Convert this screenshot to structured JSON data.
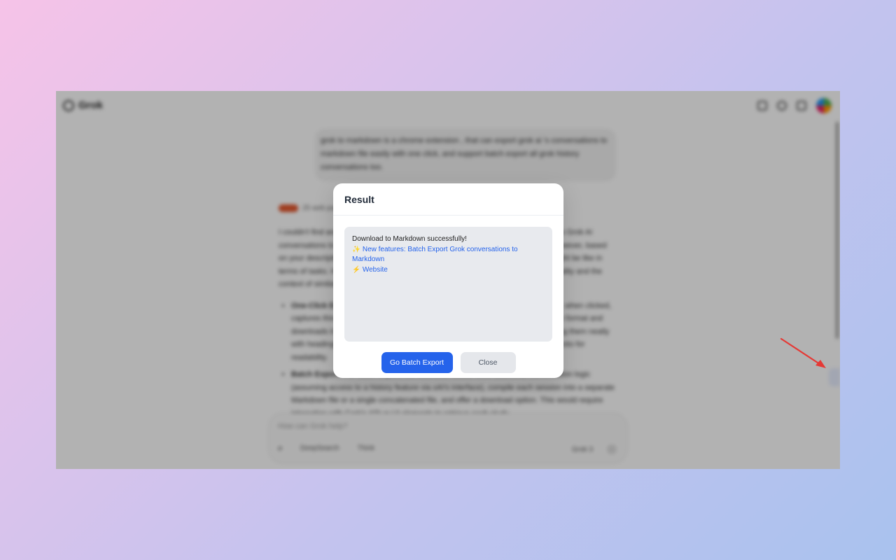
{
  "app": {
    "brand": "Grok",
    "user_message": "grok to markdown is a chrome extension , that can export grok ai 's conversations to markdown file easily with one click, and support batch export all grok history conversations too.",
    "sources_label": "25 web pages",
    "answer_intro": "I couldn't find any existing Chrome extension called \"grok to markdown\" that exports Grok AI conversations to Markdown files with one click or supports batch export directly. However, based on your description, I can outline how such an extension might work and what it might be like in terms of tasks. Here's how you might approach building one, based on the functionality and the context of similar tools:",
    "bullets": [
      {
        "title": "One-Click Export:",
        "text": "The extension would add a button to the Grok interface that, when clicked, captures this chat window, then converts the visible conversation into Markdown format and downloads it as a .md file. It would preserve user and Grok messages, formatting them neatly with headings or quotes, and keep any code blocks intact as fenced or code blocks for readability."
      },
      {
        "title": "Batch Export:",
        "text": "For batch export, the extension would need additional conversation logic (assuming access to a history feature via xAI's interface), compile each session into a separate Markdown file or a single concatenated file, and offer a download option. This would require interaction with Grok's API or UI elements to retrieve each study."
      }
    ],
    "composer_placeholder": "How can Grok help?",
    "composer_tools": [
      "DeepSearch",
      "Think"
    ],
    "model_label": "Grok 3"
  },
  "modal": {
    "title": "Result",
    "message": "Download to Markdown successfully!",
    "feature_emoji": "✨",
    "feature_link": "New features: Batch Export Grok conversations to Markdown",
    "website_emoji": "⚡",
    "website_link": "Website",
    "primary_button": "Go Batch Export",
    "secondary_button": "Close"
  },
  "colors": {
    "primary": "#2563eb",
    "arrow": "#e53935",
    "result_box": "#e8eaee"
  }
}
